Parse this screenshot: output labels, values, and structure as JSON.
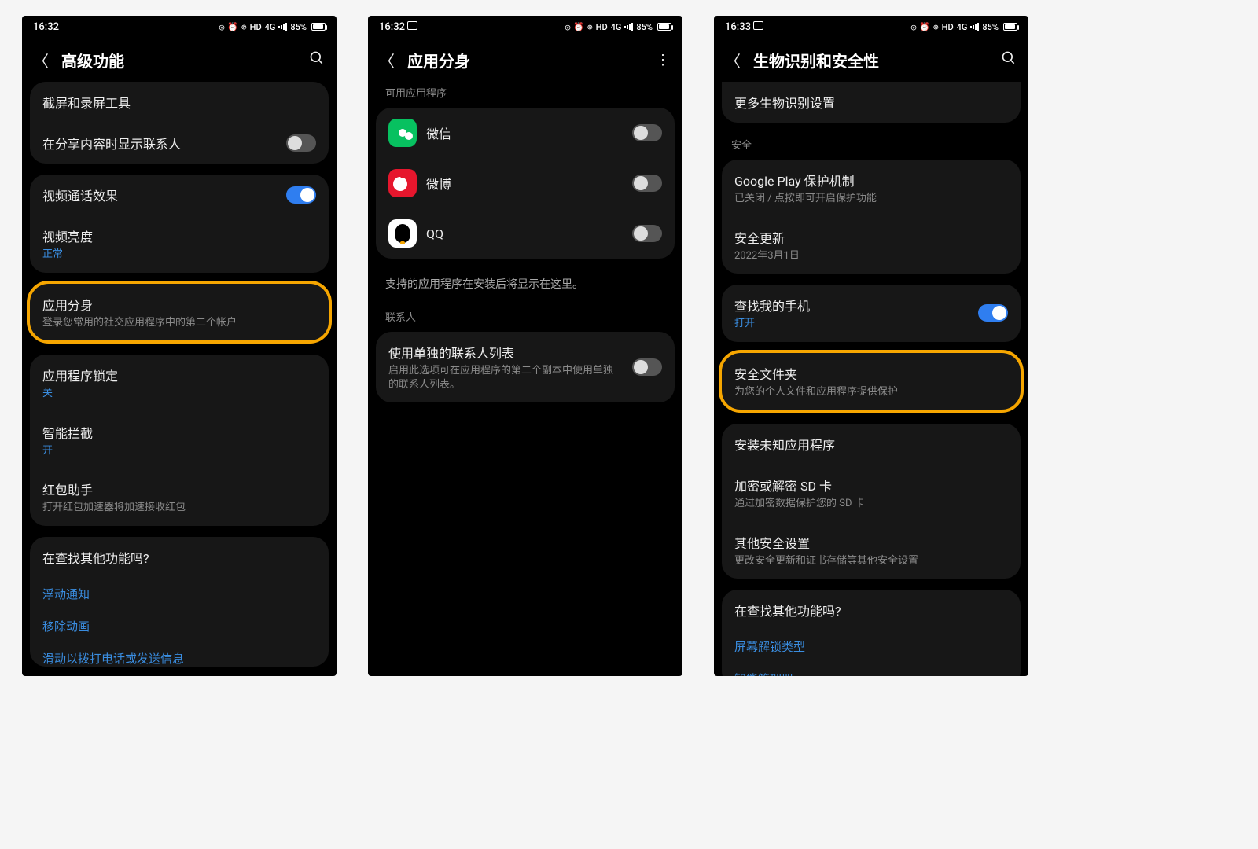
{
  "status": {
    "time1": "16:32",
    "time2": "16:32",
    "time3": "16:33",
    "battery": "85%",
    "net": "4G",
    "hd": "HD"
  },
  "phone1": {
    "title": "高级功能",
    "rows": {
      "screenshot": "截屏和录屏工具",
      "share_contacts": "在分享内容时显示联系人",
      "video_call": "视频通话效果",
      "video_brightness": "视频亮度",
      "video_brightness_sub": "正常",
      "dual_app": "应用分身",
      "dual_app_sub": "登录您常用的社交应用程序中的第二个帐户",
      "app_lock": "应用程序锁定",
      "app_lock_sub": "关",
      "smart_block": "智能拦截",
      "smart_block_sub": "开",
      "redpacket": "红包助手",
      "redpacket_sub": "打开红包加速器将加速接收红包",
      "search_title": "在查找其他功能吗?",
      "link1": "浮动通知",
      "link2": "移除动画",
      "link3": "滑动以拨打电话或发送信息"
    }
  },
  "phone2": {
    "title": "应用分身",
    "section_apps": "可用应用程序",
    "wechat": "微信",
    "weibo": "微博",
    "qq": "QQ",
    "hint": "支持的应用程序在安装后将显示在这里。",
    "section_contacts": "联系人",
    "contact_title": "使用单独的联系人列表",
    "contact_sub": "启用此选项可在应用程序的第二个副本中使用单独的联系人列表。"
  },
  "phone3": {
    "title": "生物识别和安全性",
    "more_bio": "更多生物识别设置",
    "section_security": "安全",
    "play": "Google Play 保护机制",
    "play_sub": "已关闭 / 点按即可开启保护功能",
    "update": "安全更新",
    "update_sub": "2022年3月1日",
    "find": "查找我的手机",
    "find_sub": "打开",
    "secure_folder": "安全文件夹",
    "secure_folder_sub": "为您的个人文件和应用程序提供保护",
    "unknown": "安装未知应用程序",
    "sd": "加密或解密 SD 卡",
    "sd_sub": "通过加密数据保护您的 SD 卡",
    "other": "其他安全设置",
    "other_sub": "更改安全更新和证书存储等其他安全设置",
    "search_title": "在查找其他功能吗?",
    "link1": "屏幕解锁类型",
    "link2": "智能管理器"
  }
}
